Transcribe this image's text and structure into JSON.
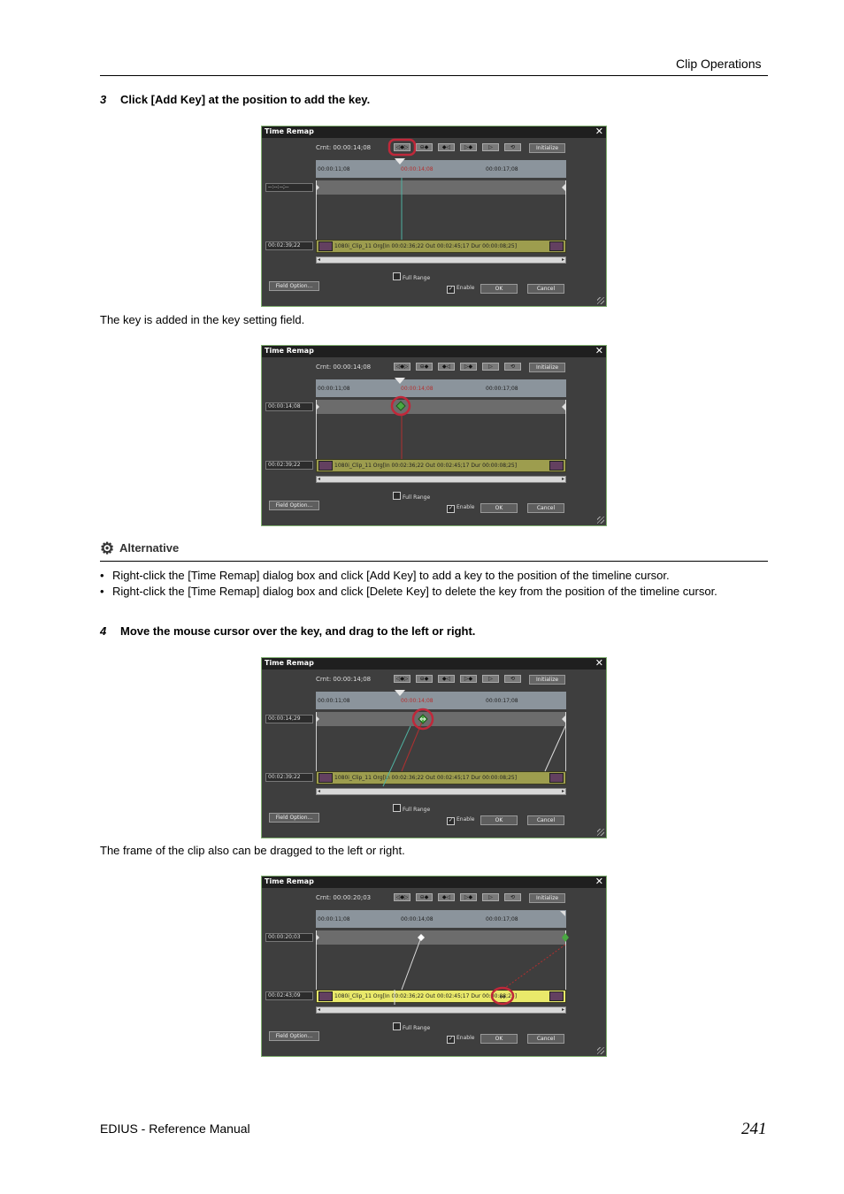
{
  "header": {
    "section": "Clip Operations"
  },
  "step3": {
    "num": "3",
    "text": "Click [Add Key] at the position to add the key."
  },
  "caption1": "The key is added in the key setting field.",
  "alternative": {
    "title": "Alternative",
    "items": [
      "Right-click the [Time Remap] dialog box and click [Add Key] to add a key to the position of the timeline cursor.",
      "Right-click the [Time Remap] dialog box and click [Delete Key] to delete the key from the position of the timeline cursor."
    ]
  },
  "step4": {
    "num": "4",
    "text": "Move the mouse cursor over the key, and drag to the left or right."
  },
  "caption2": "The frame of the clip also can be dragged to the left or right.",
  "dialog": {
    "title": "Time Remap",
    "close": "✕",
    "cnt_label": "Crnt:",
    "initialize": "Initialize",
    "ticks": [
      "00:00:11;08",
      "00:00:14;08",
      "00:00:17;08"
    ],
    "clip_label": "1080i_Clip_11  Org[In 00:02:36;22 Out 00:02:45;17 Dur 00:00:08;25]",
    "full_range": "Full Range",
    "enable": "Enable",
    "ok": "OK",
    "cancel": "Cancel",
    "field_option": "Field Option...",
    "toolbar": [
      "◁◆▷",
      "⊖◆",
      "◆◁",
      "▷◆",
      "▷",
      "⟲"
    ]
  },
  "screens": [
    {
      "current": "00:00:14;08",
      "key_field": "--:--:--;--",
      "clip_field": "00:02:39;22"
    },
    {
      "current": "00:00:14;08",
      "key_field": "00:00:14;08",
      "clip_field": "00:02:39;22"
    },
    {
      "current": "00:00:14;08",
      "key_field": "00:00:14;29",
      "clip_field": "00:02:39;22"
    },
    {
      "current": "00:00:20;03",
      "key_field": "00:00:20;03",
      "clip_field": "00:02:43;09"
    }
  ],
  "footer": {
    "manual": "EDIUS - Reference Manual",
    "page": "241"
  },
  "colors": {
    "highlight": "#c0283a",
    "key_green": "#4aa842",
    "dialog_bg": "#3e3e3e"
  }
}
